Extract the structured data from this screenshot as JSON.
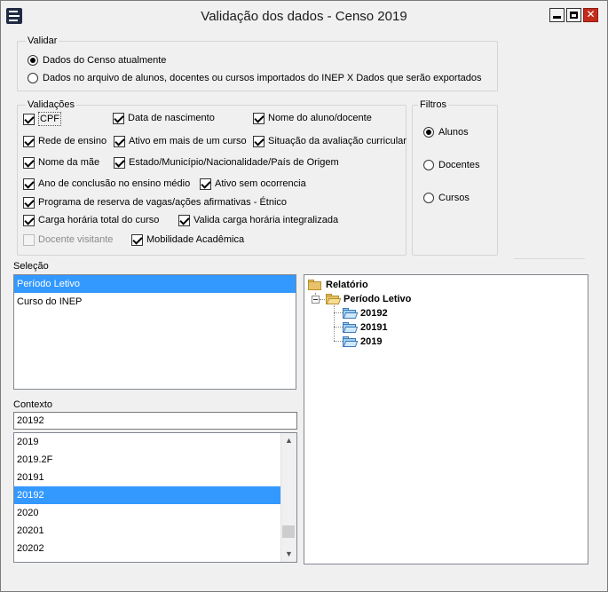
{
  "window": {
    "title": "Validação dos dados - Censo 2019",
    "close_glyph": "✕"
  },
  "validar": {
    "label": "Validar",
    "options": [
      {
        "label": "Dados do Censo atualmente",
        "selected": true
      },
      {
        "label": "Dados no arquivo de alunos, docentes ou cursos importados do INEP X Dados que serão exportados",
        "selected": false
      }
    ]
  },
  "validacoes": {
    "label": "Validações",
    "items": [
      {
        "label": "CPF",
        "checked": true,
        "enabled": true
      },
      {
        "label": "Data de nascimento",
        "checked": true,
        "enabled": true
      },
      {
        "label": "Nome do aluno/docente",
        "checked": true,
        "enabled": true
      },
      {
        "label": "Rede de ensino",
        "checked": true,
        "enabled": true
      },
      {
        "label": "Ativo em mais de um curso",
        "checked": true,
        "enabled": true
      },
      {
        "label": "Situação da avaliação curricular",
        "checked": true,
        "enabled": true
      },
      {
        "label": "Nome da mãe",
        "checked": true,
        "enabled": true
      },
      {
        "label": "Estado/Município/Nacionalidade/País de Origem",
        "checked": true,
        "enabled": true
      },
      {
        "label": "Ano de conclusão no ensino médio",
        "checked": true,
        "enabled": true
      },
      {
        "label": "Ativo sem ocorrencia",
        "checked": true,
        "enabled": true
      },
      {
        "label": "Programa de reserva de vagas/ações afirmativas - Étnico",
        "checked": true,
        "enabled": true
      },
      {
        "label": "Carga horária total do curso",
        "checked": true,
        "enabled": true
      },
      {
        "label": "Valida carga horária integralizada",
        "checked": true,
        "enabled": true
      },
      {
        "label": "Docente visitante",
        "checked": false,
        "enabled": false
      },
      {
        "label": "Mobilidade Acadêmica",
        "checked": true,
        "enabled": true
      }
    ]
  },
  "filtros": {
    "label": "Filtros",
    "options": [
      {
        "label": "Alunos",
        "selected": true
      },
      {
        "label": "Docentes",
        "selected": false
      },
      {
        "label": "Cursos",
        "selected": false
      }
    ]
  },
  "selecao": {
    "label": "Seleção",
    "items": [
      {
        "label": "Período Letivo",
        "selected": true
      },
      {
        "label": "Curso do INEP",
        "selected": false
      }
    ]
  },
  "contexto": {
    "label": "Contexto",
    "value": "20192",
    "items": [
      {
        "label": "2019",
        "selected": false
      },
      {
        "label": "2019.2F",
        "selected": false
      },
      {
        "label": "20191",
        "selected": false
      },
      {
        "label": "20192",
        "selected": true
      },
      {
        "label": "2020",
        "selected": false
      },
      {
        "label": "20201",
        "selected": false
      },
      {
        "label": "20202",
        "selected": false
      }
    ],
    "scroll_position": 0.9
  },
  "relatorio": {
    "root": "Relatório",
    "child": "Período Letivo",
    "leaves": [
      "20192",
      "20191",
      "2019"
    ]
  }
}
